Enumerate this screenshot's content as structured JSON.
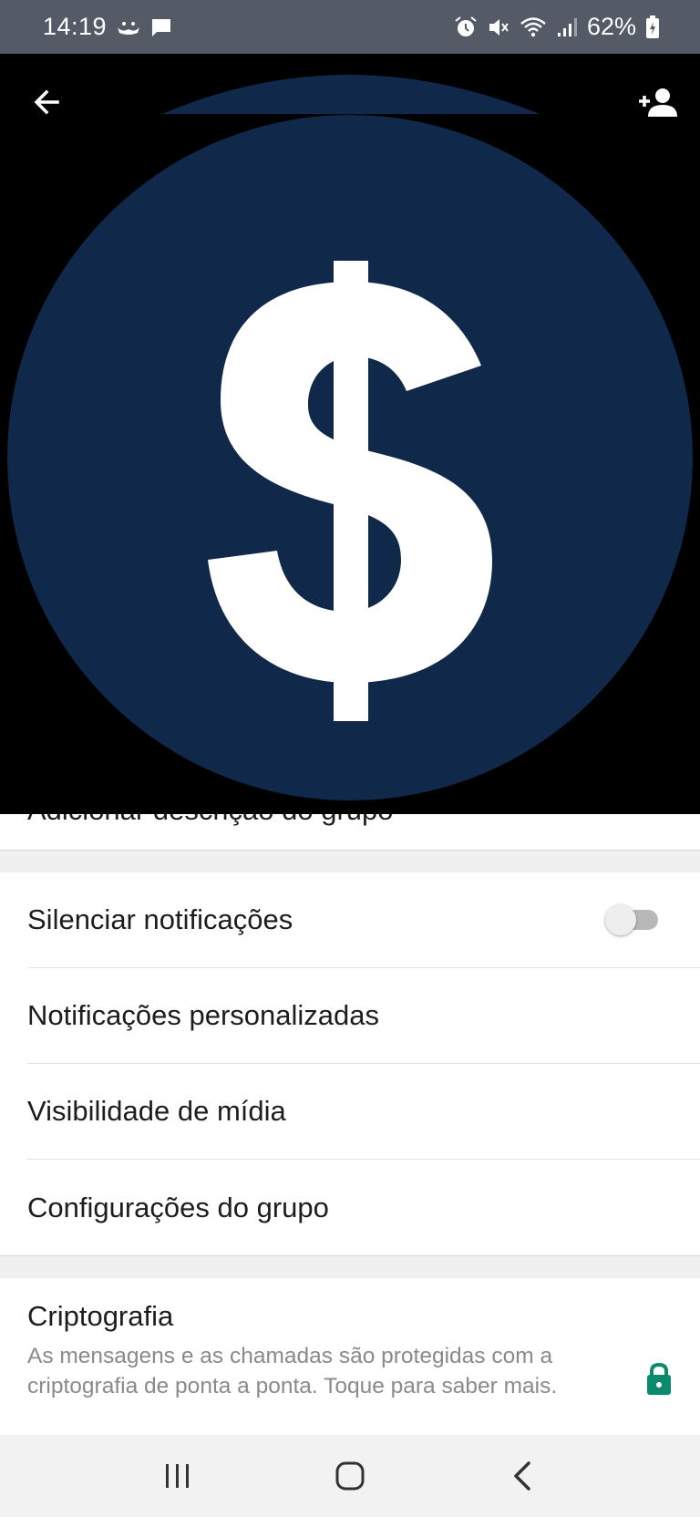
{
  "status_bar": {
    "time": "14:19",
    "battery": "62%",
    "icons": [
      "notification-app-icon",
      "message-icon",
      "alarm-icon",
      "mute-icon",
      "wifi-icon",
      "signal-icon",
      "battery-icon"
    ]
  },
  "header": {
    "back_icon": "arrow-left-icon",
    "add_participant_icon": "person-add-icon",
    "photo": {
      "background": "#000000",
      "circle_color": "#10294a",
      "symbol": "$",
      "symbol_color": "#ffffff"
    }
  },
  "description_strip": {
    "partial_text": "Adicionar descrição do grupo"
  },
  "settings": {
    "items": [
      {
        "label": "Silenciar notificações",
        "toggle": false
      },
      {
        "label": "Notificações personalizadas"
      },
      {
        "label": "Visibilidade de mídia"
      },
      {
        "label": "Configurações do grupo"
      }
    ]
  },
  "encryption": {
    "title": "Criptografia",
    "description": "As mensagens e as chamadas são protegidas com a criptografia de ponta a ponta. Toque para saber mais.",
    "icon": "lock-icon",
    "icon_color": "#0b8a6d"
  },
  "nav_bar": {
    "buttons": [
      "recent-apps-icon",
      "home-icon",
      "back-icon"
    ]
  }
}
